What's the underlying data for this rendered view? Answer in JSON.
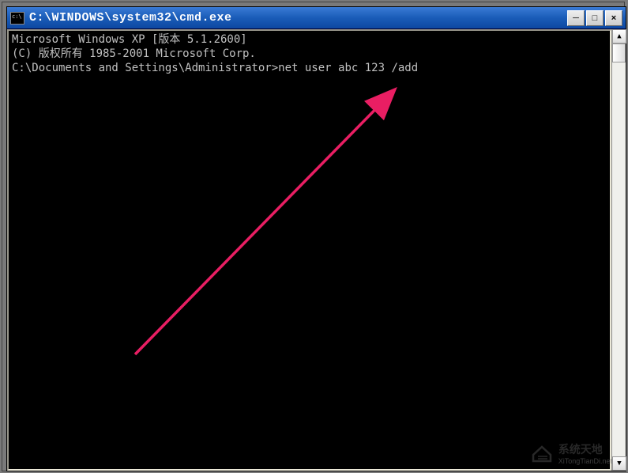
{
  "titlebar": {
    "icon": "cmd-icon",
    "title": "C:\\WINDOWS\\system32\\cmd.exe",
    "minimize": "─",
    "maximize": "□",
    "close": "×"
  },
  "console": {
    "line1": "Microsoft Windows XP [版本 5.1.2600]",
    "line2": "(C) 版权所有 1985-2001 Microsoft Corp.",
    "line3": "",
    "prompt": "C:\\Documents and Settings\\Administrator>",
    "command": "net user abc 123 /add"
  },
  "scrollbar": {
    "up": "▲",
    "down": "▼"
  },
  "watermark": {
    "main": "系统天地",
    "sub": "XiTongTianDi.net"
  },
  "annotation": {
    "arrow_color": "#e91e63"
  }
}
